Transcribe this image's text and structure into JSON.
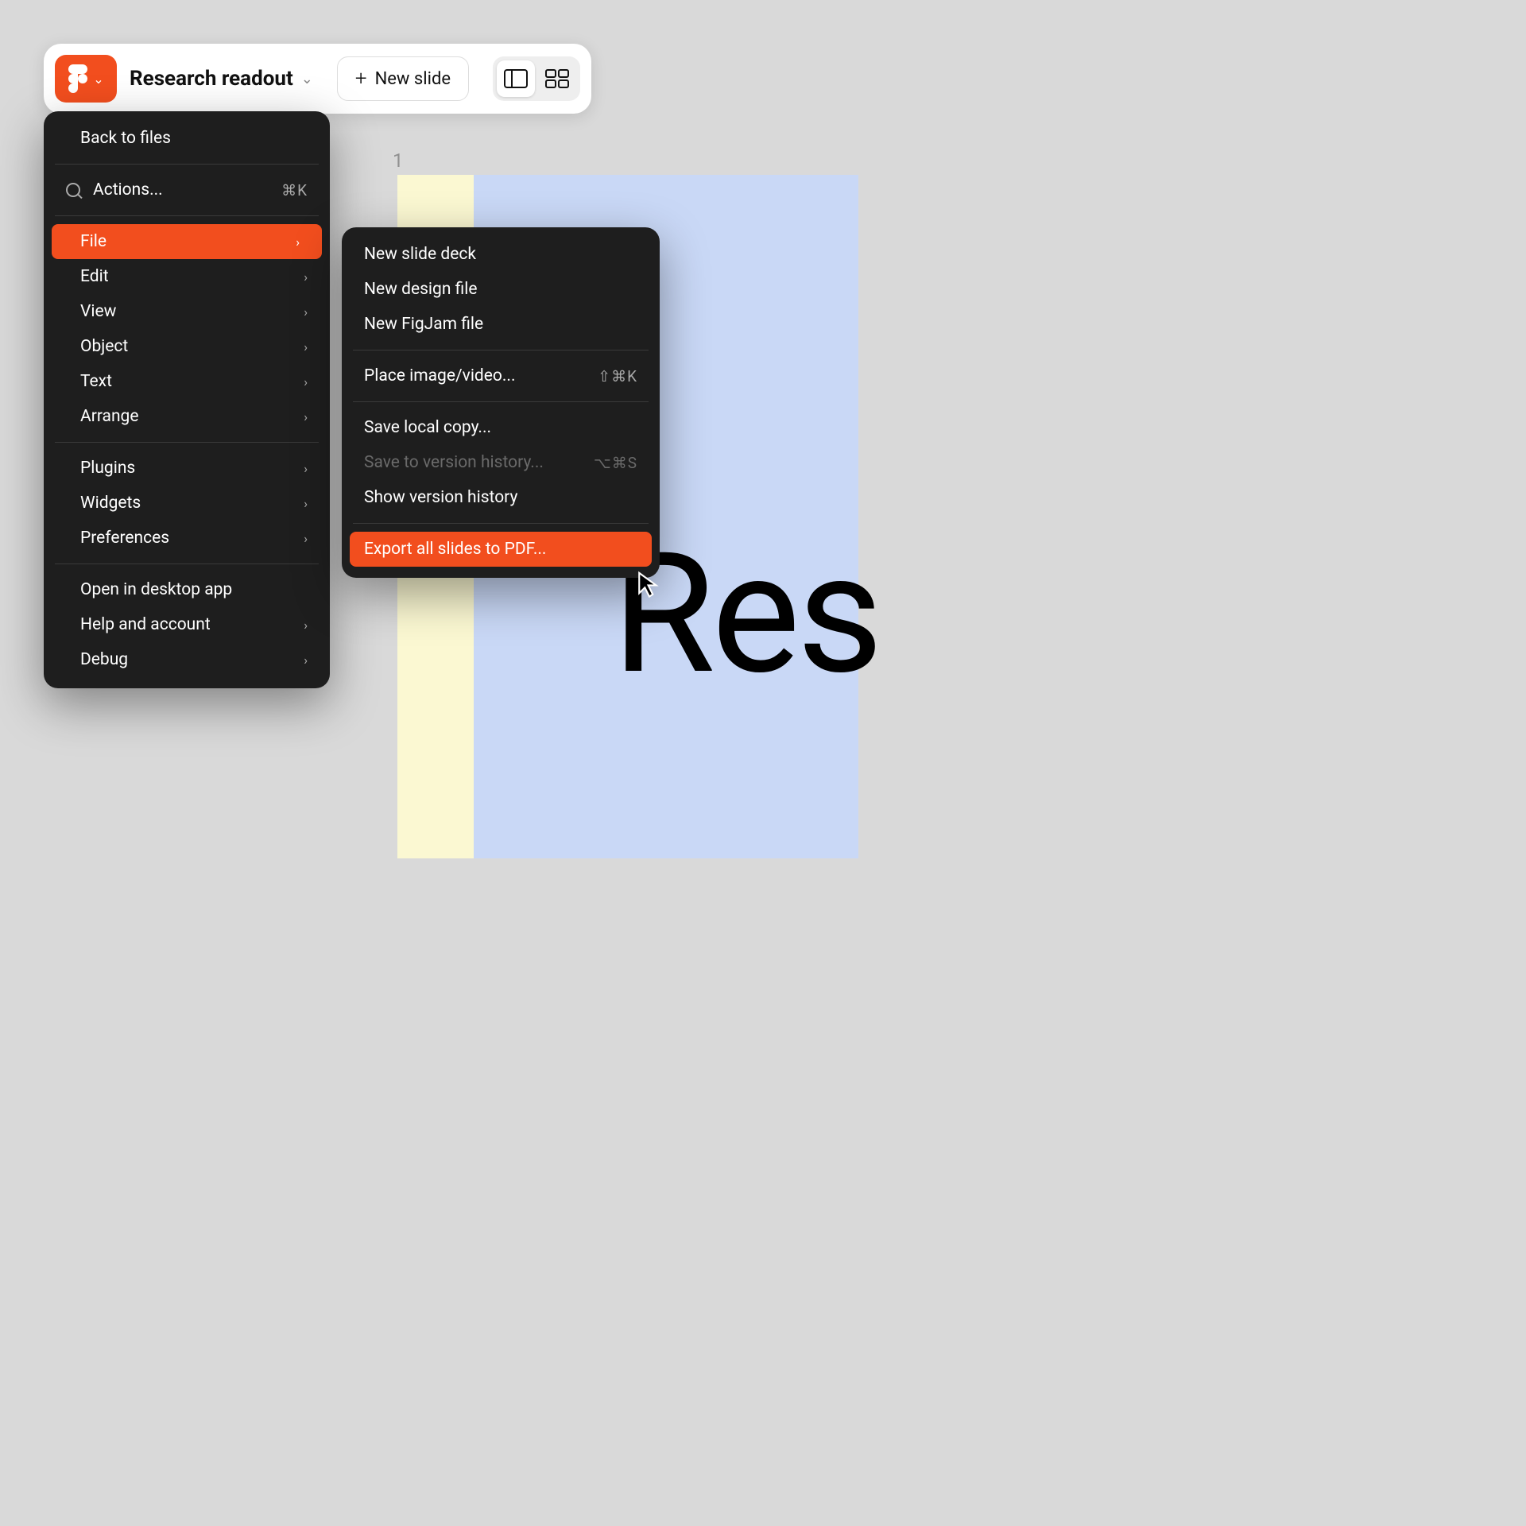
{
  "toolbar": {
    "file_name": "Research readout",
    "new_slide": "New slide"
  },
  "canvas": {
    "slide_number": "1",
    "slide_title_fragment": "Res"
  },
  "menu": {
    "back": "Back to files",
    "actions": "Actions...",
    "actions_shortcut": "⌘K",
    "file": "File",
    "edit": "Edit",
    "view": "View",
    "object": "Object",
    "text": "Text",
    "arrange": "Arrange",
    "plugins": "Plugins",
    "widgets": "Widgets",
    "preferences": "Preferences",
    "open_desktop": "Open in desktop app",
    "help": "Help and account",
    "debug": "Debug"
  },
  "submenu": {
    "new_deck": "New slide deck",
    "new_design": "New design file",
    "new_figjam": "New FigJam file",
    "place_image": "Place image/video...",
    "place_image_shortcut": "⇧⌘K",
    "save_local": "Save local copy...",
    "save_version": "Save to version history...",
    "save_version_shortcut": "⌥⌘S",
    "show_version": "Show version history",
    "export_pdf": "Export all slides to PDF..."
  },
  "colors": {
    "accent": "#f24e1e",
    "menu_bg": "#1e1e1e",
    "slide_bg": "#c9d8f6",
    "notes_bg": "#fbf8d2"
  }
}
